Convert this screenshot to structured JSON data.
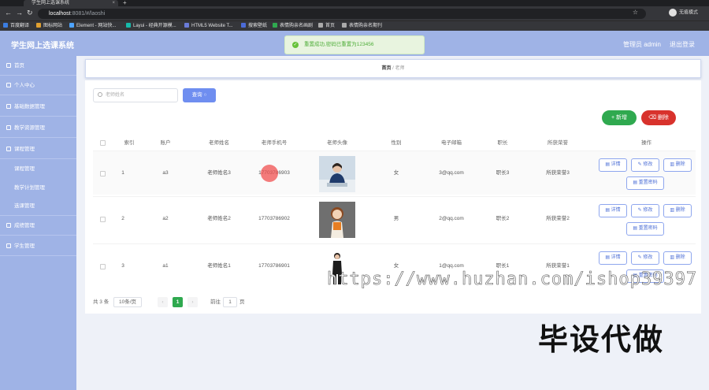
{
  "browser": {
    "tab_title": "学生网上选课系统",
    "url_host": "localhost",
    "url_path": ":8081/#/laoshi",
    "profile_label": "无痕模式",
    "bookmarks": [
      {
        "label": "百度翻译",
        "color": "#3b7de0"
      },
      {
        "label": "图标网站",
        "color": "#e0a030"
      },
      {
        "label": "Element - 网站快...",
        "color": "#4da3ff"
      },
      {
        "label": "Layui - 经典开源模...",
        "color": "#16baaa"
      },
      {
        "label": "HTML5 Website T...",
        "color": "#6a7bd8"
      },
      {
        "label": "搜索壁纸",
        "color": "#4b6bd8"
      },
      {
        "label": "表情购亲名画剧",
        "color": "#2fa94f"
      },
      {
        "label": "首页",
        "color": "#aaaaaa"
      },
      {
        "label": "表情购亲名期刊",
        "color": "#aaaaaa"
      }
    ]
  },
  "header": {
    "title": "学生网上选课系统",
    "admin": "管理员 admin",
    "logout": "退出登录"
  },
  "toast": {
    "text": "重置成功,密码已重置为123456"
  },
  "sidebar": {
    "items": [
      {
        "label": "首页"
      },
      {
        "label": "个人中心"
      },
      {
        "label": "基础数据管理"
      },
      {
        "label": "教学资源管理"
      },
      {
        "label": "课程管理"
      },
      {
        "label": "课程管理"
      },
      {
        "label": "教学计划管理"
      },
      {
        "label": "选课管理"
      },
      {
        "label": "成绩管理"
      },
      {
        "label": "学生管理"
      }
    ]
  },
  "breadcrumb": {
    "home": "首页",
    "separator": "/",
    "current": "老师"
  },
  "toolbar": {
    "search_placeholder": "老师姓名",
    "query_label": "查询",
    "add_label": "新增",
    "delete_label": "删除"
  },
  "table": {
    "headers": [
      "索引",
      "账户",
      "老师姓名",
      "老师手机号",
      "老师头像",
      "性别",
      "电子邮箱",
      "职长",
      "所获荣誉",
      "操作"
    ],
    "rows": [
      {
        "index": "1",
        "account": "a3",
        "name": "老师姓名3",
        "phone": "17703786903",
        "gender": "女",
        "email": "3@qq.com",
        "title": "职长3",
        "honor": "所获荣誉3"
      },
      {
        "index": "2",
        "account": "a2",
        "name": "老师姓名2",
        "phone": "17703786902",
        "gender": "男",
        "email": "2@qq.com",
        "title": "职长2",
        "honor": "所获荣誉2"
      },
      {
        "index": "3",
        "account": "a1",
        "name": "老师姓名1",
        "phone": "17703786901",
        "gender": "女",
        "email": "1@qq.com",
        "title": "职长1",
        "honor": "所获荣誉1"
      }
    ],
    "actions": {
      "detail": "详情",
      "edit": "修改",
      "delete": "删除",
      "reset": "重置密码"
    }
  },
  "pagination": {
    "total": "共 3 条",
    "page_size": "10条/页",
    "current_page": "1",
    "goto_label": "前往",
    "goto_value": "1",
    "page_unit": "页"
  },
  "watermark": "https://www.huzhan.com/ishop39397",
  "overlay_text": "毕设代做",
  "colors": {
    "sidebar": "#9fb3e6",
    "primary": "#6f8ef0",
    "success": "#2fa94f",
    "danger": "#d8322c"
  }
}
